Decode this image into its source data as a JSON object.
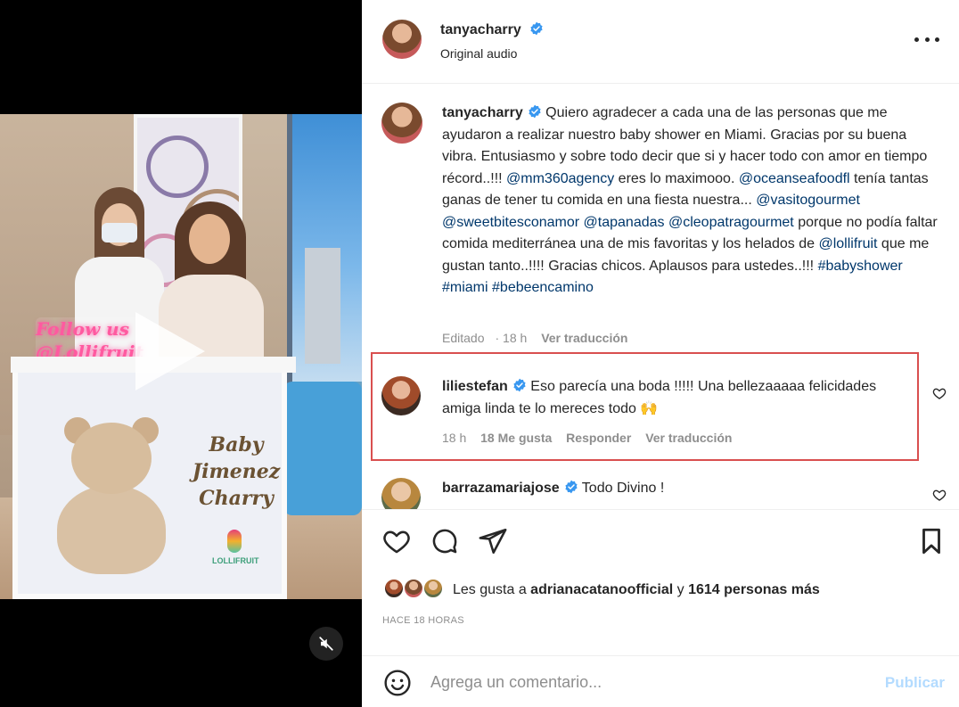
{
  "post_author": {
    "username": "tanyacharry",
    "audio_label": "Original audio"
  },
  "media": {
    "neon_line1": "Follow us",
    "neon_line2": "@Lollifruit",
    "cart_text_line1": "Baby",
    "cart_text_line2": "Jimenez",
    "cart_text_line3": "Charry",
    "logo_text": "LOLLIFRUIT"
  },
  "caption": {
    "username": "tanyacharry",
    "segments": [
      {
        "t": "text",
        "v": "Quiero agradecer a cada una de las personas que me ayudaron a realizar nuestro baby shower en Miami. Gracias por su buena vibra. Entusiasmo y sobre todo decir que si y hacer todo con amor en tiempo récord..!!! "
      },
      {
        "t": "mention",
        "v": "@mm360agency"
      },
      {
        "t": "text",
        "v": " eres lo maximooo. "
      },
      {
        "t": "mention",
        "v": "@oceanseafoodfl"
      },
      {
        "t": "text",
        "v": " tenía tantas ganas de tener tu comida en una fiesta nuestra... "
      },
      {
        "t": "mention",
        "v": "@vasitogourmet"
      },
      {
        "t": "text",
        "v": " "
      },
      {
        "t": "mention",
        "v": "@sweetbitesconamor"
      },
      {
        "t": "text",
        "v": " "
      },
      {
        "t": "mention",
        "v": "@tapanadas"
      },
      {
        "t": "text",
        "v": " "
      },
      {
        "t": "mention",
        "v": "@cleopatragourmet"
      },
      {
        "t": "text",
        "v": " porque no podía faltar comida mediterránea una de mis favoritas y los helados de "
      },
      {
        "t": "mention",
        "v": "@lollifruit"
      },
      {
        "t": "text",
        "v": " que me gustan tanto..!!!! Gracias chicos. Aplausos para ustedes..!!! "
      },
      {
        "t": "mention",
        "v": "#babyshower"
      },
      {
        "t": "text",
        "v": " "
      },
      {
        "t": "mention",
        "v": "#miami"
      },
      {
        "t": "text",
        "v": " "
      },
      {
        "t": "mention",
        "v": "#bebeencamino"
      }
    ],
    "edited": "Editado",
    "time": "18 h",
    "translate": "Ver traducción"
  },
  "comments": [
    {
      "username": "liliestefan",
      "text": "Eso parecía una boda !!!!! Una bellezaaaaa felicidades amiga linda te lo mereces todo 🙌",
      "time": "18 h",
      "likes": "18 Me gusta",
      "reply": "Responder",
      "translate": "Ver traducción"
    },
    {
      "username": "barrazamariajose",
      "text": "Todo Divino !"
    }
  ],
  "likes": {
    "prefix": "Les gusta a ",
    "user": "adrianacatanoofficial",
    "middle": " y ",
    "count": "1614 personas más"
  },
  "time_ago": "HACE 18 HORAS",
  "compose": {
    "placeholder": "Agrega un comentario...",
    "publish_label": "Publicar"
  },
  "colors": {
    "verified": "#3897f0",
    "mention": "#00376b",
    "highlight_border": "#d94f4f",
    "publish_disabled": "#b3dbff"
  }
}
